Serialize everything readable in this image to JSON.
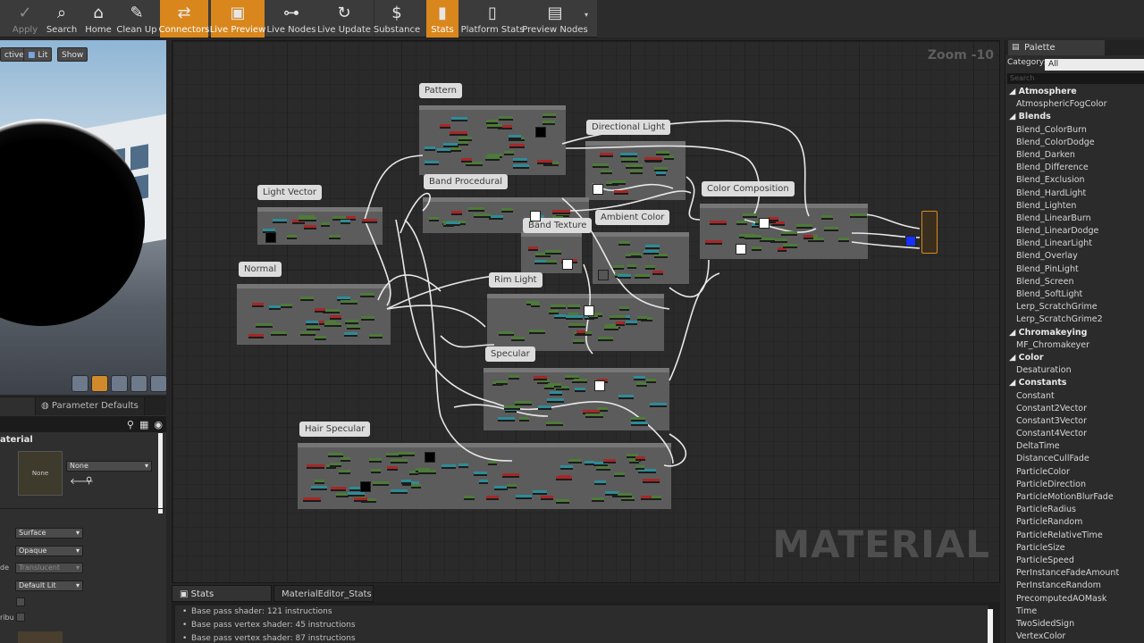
{
  "toolbar": {
    "buttons": [
      {
        "label": "Apply",
        "icon": "check-icon",
        "state": "disabled"
      },
      {
        "label": "Search",
        "icon": "binoculars-icon"
      },
      {
        "label": "Home",
        "icon": "home-icon"
      },
      {
        "label": "Clean Up",
        "icon": "broom-icon"
      },
      {
        "label": "Connectors",
        "icon": "connectors-icon",
        "state": "active"
      },
      {
        "label": "Live Preview",
        "icon": "monitor-check-icon",
        "state": "active"
      },
      {
        "label": "Live Nodes",
        "icon": "nodes-icon"
      },
      {
        "label": "Live Update",
        "icon": "refresh-icon"
      },
      {
        "label": "Substance",
        "icon": "substance-icon"
      },
      {
        "label": "Stats",
        "icon": "bar-chart-icon",
        "state": "active"
      },
      {
        "label": "Platform Stats",
        "icon": "phone-chart-icon"
      },
      {
        "label": "Preview Nodes",
        "icon": "preview-nodes-icon"
      }
    ]
  },
  "viewport": {
    "chips": [
      "ctive",
      "Lit",
      "Show"
    ]
  },
  "details": {
    "tab_label": "Parameter Defaults",
    "section_title": "aterial",
    "thumb_label": "None",
    "texture_value": "None",
    "blend_mode": "Surface",
    "opacity_mode": "Opaque",
    "translucency": "Translucent",
    "shading_model": "Default Lit",
    "label_de": "de",
    "label_ribu": "ribu"
  },
  "graph": {
    "zoom": "Zoom -10",
    "watermark": "MATERIAL",
    "comments": [
      {
        "title": "Pattern"
      },
      {
        "title": "Directional Light"
      },
      {
        "title": "Light Vector"
      },
      {
        "title": "Band Procedural"
      },
      {
        "title": "Color Composition"
      },
      {
        "title": "Band Texture"
      },
      {
        "title": "Ambient Color"
      },
      {
        "title": "Normal"
      },
      {
        "title": "Rim Light"
      },
      {
        "title": "Specular"
      },
      {
        "title": "Hair Specular"
      }
    ]
  },
  "palette": {
    "tab": "Palette",
    "category_label": "Category:",
    "category_value": "All",
    "search_placeholder": "Search",
    "items": [
      {
        "t": "cat",
        "label": "Atmosphere"
      },
      {
        "t": "leaf",
        "label": "AtmosphericFogColor"
      },
      {
        "t": "cat",
        "label": "Blends"
      },
      {
        "t": "leaf",
        "label": "Blend_ColorBurn"
      },
      {
        "t": "leaf",
        "label": "Blend_ColorDodge"
      },
      {
        "t": "leaf",
        "label": "Blend_Darken"
      },
      {
        "t": "leaf",
        "label": "Blend_Difference"
      },
      {
        "t": "leaf",
        "label": "Blend_Exclusion"
      },
      {
        "t": "leaf",
        "label": "Blend_HardLight"
      },
      {
        "t": "leaf",
        "label": "Blend_Lighten"
      },
      {
        "t": "leaf",
        "label": "Blend_LinearBurn"
      },
      {
        "t": "leaf",
        "label": "Blend_LinearDodge"
      },
      {
        "t": "leaf",
        "label": "Blend_LinearLight"
      },
      {
        "t": "leaf",
        "label": "Blend_Overlay"
      },
      {
        "t": "leaf",
        "label": "Blend_PinLight"
      },
      {
        "t": "leaf",
        "label": "Blend_Screen"
      },
      {
        "t": "leaf",
        "label": "Blend_SoftLight"
      },
      {
        "t": "leaf",
        "label": "Lerp_ScratchGrime"
      },
      {
        "t": "leaf",
        "label": "Lerp_ScratchGrime2"
      },
      {
        "t": "cat",
        "label": "Chromakeying"
      },
      {
        "t": "leaf",
        "label": "MF_Chromakeyer"
      },
      {
        "t": "cat",
        "label": "Color"
      },
      {
        "t": "leaf",
        "label": "Desaturation"
      },
      {
        "t": "cat",
        "label": "Constants"
      },
      {
        "t": "leaf",
        "label": "Constant"
      },
      {
        "t": "leaf",
        "label": "Constant2Vector"
      },
      {
        "t": "leaf",
        "label": "Constant3Vector"
      },
      {
        "t": "leaf",
        "label": "Constant4Vector"
      },
      {
        "t": "leaf",
        "label": "DeltaTime"
      },
      {
        "t": "leaf",
        "label": "DistanceCullFade"
      },
      {
        "t": "leaf",
        "label": "ParticleColor"
      },
      {
        "t": "leaf",
        "label": "ParticleDirection"
      },
      {
        "t": "leaf",
        "label": "ParticleMotionBlurFade"
      },
      {
        "t": "leaf",
        "label": "ParticleRadius"
      },
      {
        "t": "leaf",
        "label": "ParticleRandom"
      },
      {
        "t": "leaf",
        "label": "ParticleRelativeTime"
      },
      {
        "t": "leaf",
        "label": "ParticleSize"
      },
      {
        "t": "leaf",
        "label": "ParticleSpeed"
      },
      {
        "t": "leaf",
        "label": "PerInstanceFadeAmount"
      },
      {
        "t": "leaf",
        "label": "PerInstanceRandom"
      },
      {
        "t": "leaf",
        "label": "PrecomputedAOMask"
      },
      {
        "t": "leaf",
        "label": "Time"
      },
      {
        "t": "leaf",
        "label": "TwoSidedSign"
      },
      {
        "t": "leaf",
        "label": "VertexColor"
      }
    ]
  },
  "bottom": {
    "tabs": [
      "Stats",
      "MaterialEditor_Stats"
    ],
    "lines": [
      "Base pass shader: 121 instructions",
      "Base pass vertex shader: 45 instructions",
      "Base pass vertex shader: 87 instructions"
    ]
  },
  "colors": {
    "accent": "#d9861c",
    "node_green": "#4e7a3a",
    "node_teal": "#2f8b96",
    "node_red": "#a52828"
  }
}
